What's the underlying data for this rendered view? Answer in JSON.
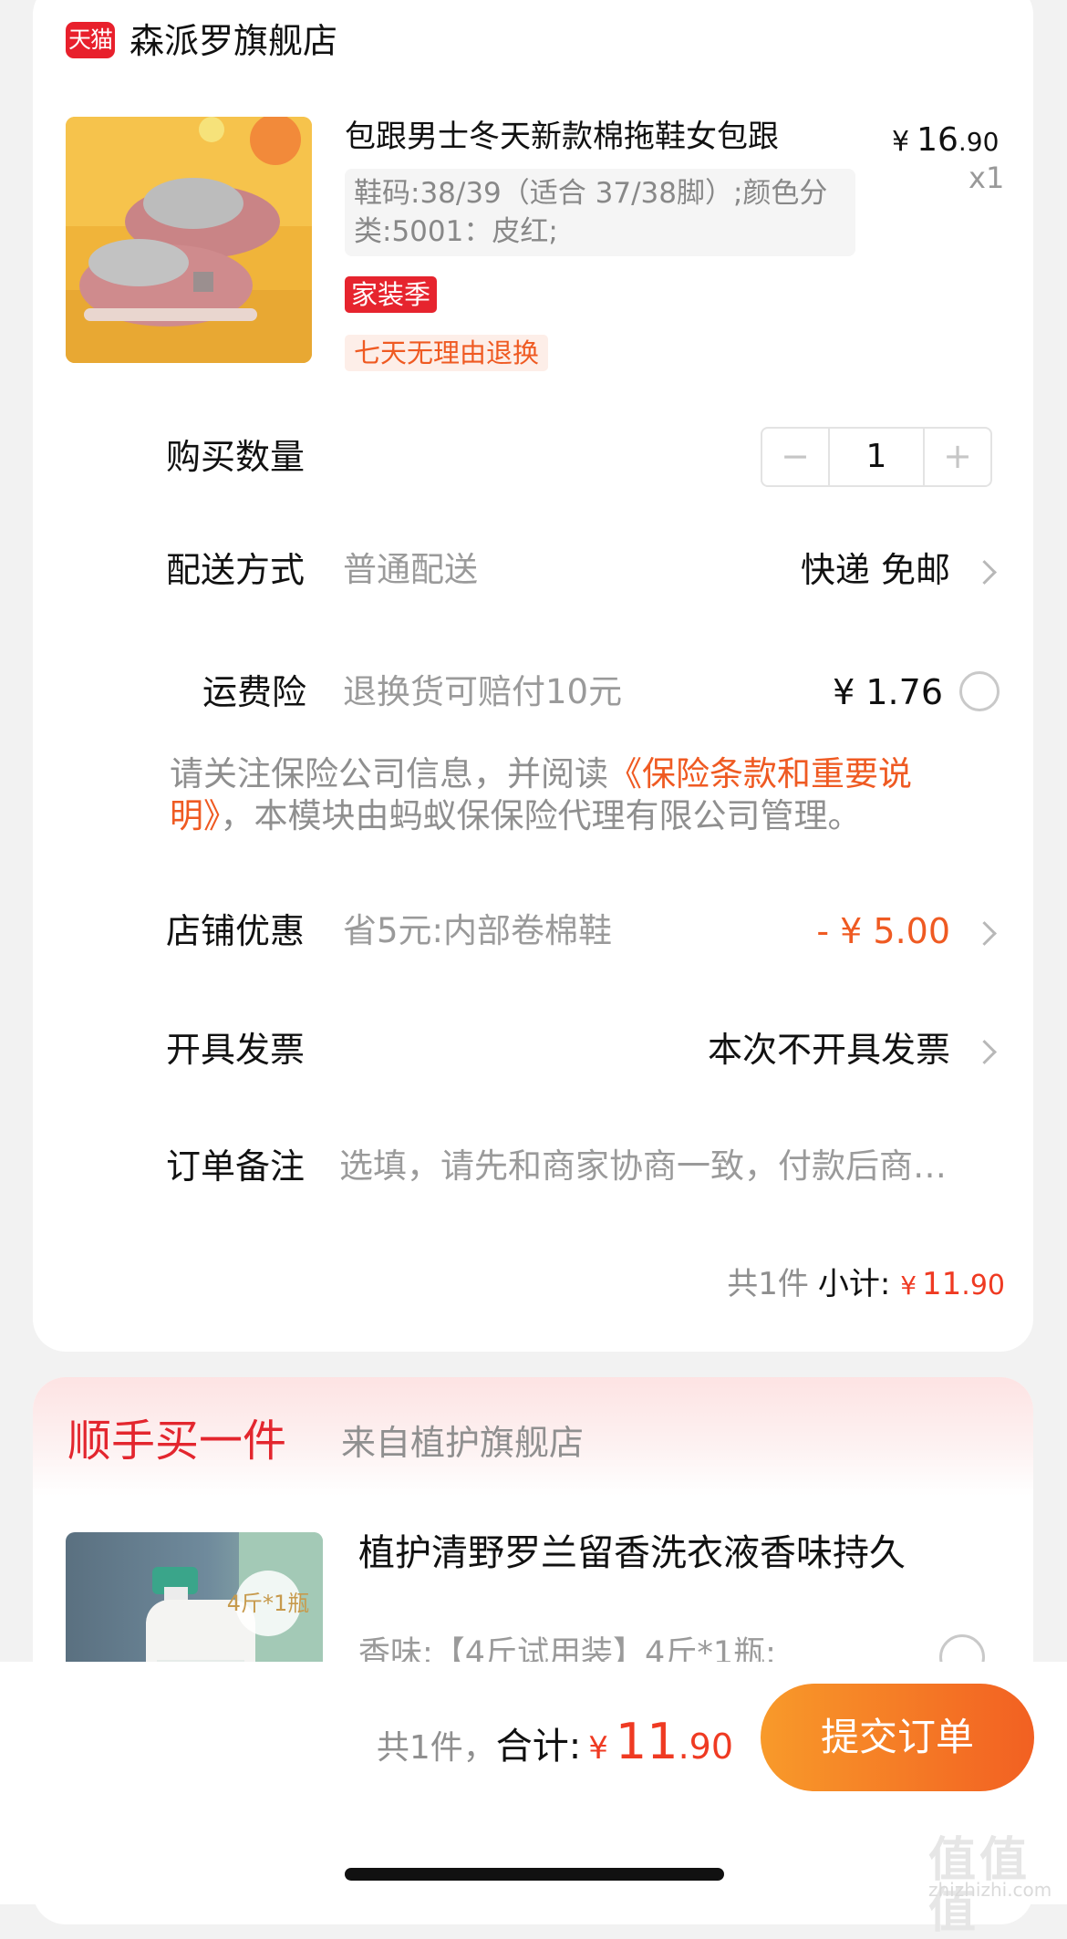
{
  "shop": {
    "badge": "天猫",
    "name": "森派罗旗舰店"
  },
  "product": {
    "title": "包跟男士冬天新款棉拖鞋女包跟",
    "spec": "鞋码:38/39（适合 37/38脚）;颜色分类:5001：皮红;",
    "price_currency": "¥",
    "price_int": "16",
    "price_dec": ".90",
    "qty": "x1",
    "tag_season": "家装季",
    "tag_return": "七天无理由退换"
  },
  "quantity": {
    "label": "购买数量",
    "minus": "−",
    "value": "1",
    "plus": "+"
  },
  "shipping": {
    "label": "配送方式",
    "sub": "普通配送",
    "value": "快递 免邮"
  },
  "insurance": {
    "label": "运费险",
    "sub": "退换货可赔付10元",
    "value": "¥ 1.76"
  },
  "notice": {
    "text": "请关注保险公司信息，并阅读",
    "link": "《保险条款和重要说明》",
    "text2": "，本模块由蚂蚁保保险代理有限公司管理。"
  },
  "store_discount": {
    "label": "店铺优惠",
    "sub": "省5元:内部卷棉鞋",
    "value": "- ¥ 5.00"
  },
  "invoice": {
    "label": "开具发票",
    "value": "本次不开具发票"
  },
  "remark": {
    "label": "订单备注",
    "placeholder": "选填，请先和商家协商一致，付款后商…"
  },
  "subtotal": {
    "count": "共1件",
    "label": "小计:",
    "currency": "¥",
    "int": "11",
    "dec": ".90"
  },
  "addon": {
    "title": "顺手买一件",
    "from": "来自植护旗舰店",
    "product_title": "植护清野罗兰留香洗衣液香味持久",
    "product_spec": "香味:【4斤试用装】4斤*1瓶;",
    "thumb_badge": "4斤*1瓶"
  },
  "bottom": {
    "count": "共1件，",
    "label": "合计:",
    "currency": "¥",
    "int": "11",
    "dec": ".90",
    "submit": "提交订单"
  },
  "watermark": {
    "glyphs": "值值值",
    "site": "zhizhizhi.com"
  },
  "colors": {
    "accent": "#ef5a22",
    "tmall_red": "#e8202c",
    "submit_start": "#f89a2a",
    "submit_end": "#f26022"
  }
}
